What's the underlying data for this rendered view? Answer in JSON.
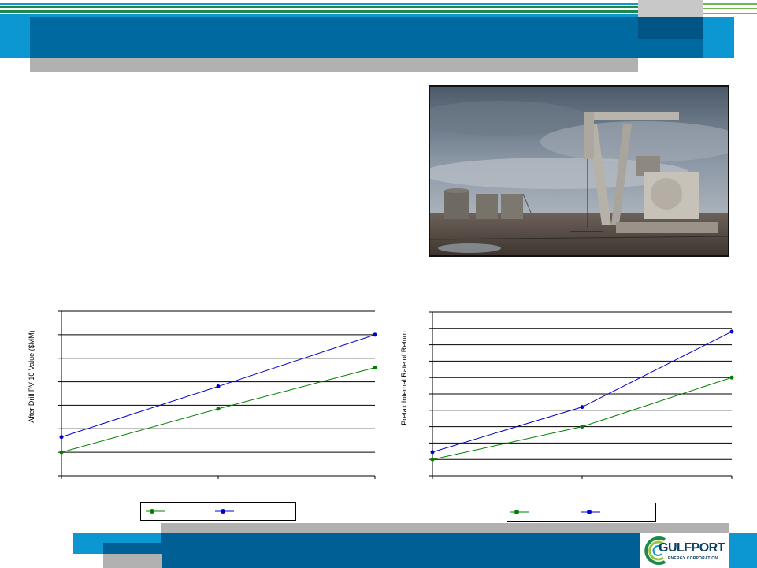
{
  "colors": {
    "header_blue": "#0069a0",
    "accent_cyan": "#0c97d3",
    "stripe_green": "#1d8a4a",
    "gray": "#b1b1b1",
    "series_green": "#008000",
    "series_blue": "#0000cc",
    "footer_blue": "#005f95"
  },
  "header": {
    "title": ""
  },
  "photo": {
    "subject": "pumpjack-oil-well"
  },
  "charts": [
    {
      "type": "line",
      "ylabel": "After Drill PV-10 Value ($MM)",
      "x": [
        0,
        1,
        2
      ],
      "ylim": [
        0,
        7
      ],
      "y_gridlines": 7,
      "series": [
        {
          "values": [
            1.0,
            2.85,
            4.6
          ],
          "color": "#008000"
        },
        {
          "values": [
            1.65,
            3.8,
            6.0
          ],
          "color": "#0000cc"
        }
      ]
    },
    {
      "type": "line",
      "ylabel": "Pretax Internal Rate of Return",
      "x": [
        0,
        1,
        2
      ],
      "ylim": [
        0,
        10
      ],
      "y_gridlines": 10,
      "series": [
        {
          "values": [
            1.0,
            3.0,
            6.0
          ],
          "color": "#008000"
        },
        {
          "values": [
            1.45,
            4.2,
            8.8
          ],
          "color": "#0000cc"
        }
      ]
    }
  ],
  "chart_data": [
    {
      "type": "line",
      "title": "",
      "xlabel": "",
      "ylabel": "After Drill PV-10 Value ($MM)",
      "x": [
        0,
        1,
        2
      ],
      "ylim": [
        0,
        7
      ],
      "series": [
        {
          "values": [
            1.0,
            2.85,
            4.6
          ]
        },
        {
          "values": [
            1.65,
            3.8,
            6.0
          ]
        }
      ],
      "grid": true,
      "legend": "bottom"
    },
    {
      "type": "line",
      "title": "",
      "xlabel": "",
      "ylabel": "Pretax Internal Rate of Return",
      "x": [
        0,
        1,
        2
      ],
      "ylim": [
        0,
        10
      ],
      "series": [
        {
          "values": [
            1.0,
            3.0,
            6.0
          ]
        },
        {
          "values": [
            1.45,
            4.2,
            8.8
          ]
        }
      ],
      "grid": true,
      "legend": "bottom"
    }
  ],
  "footer": {
    "logo_name": "GULFPORT",
    "logo_tagline": "ENERGY CORPORATION"
  }
}
